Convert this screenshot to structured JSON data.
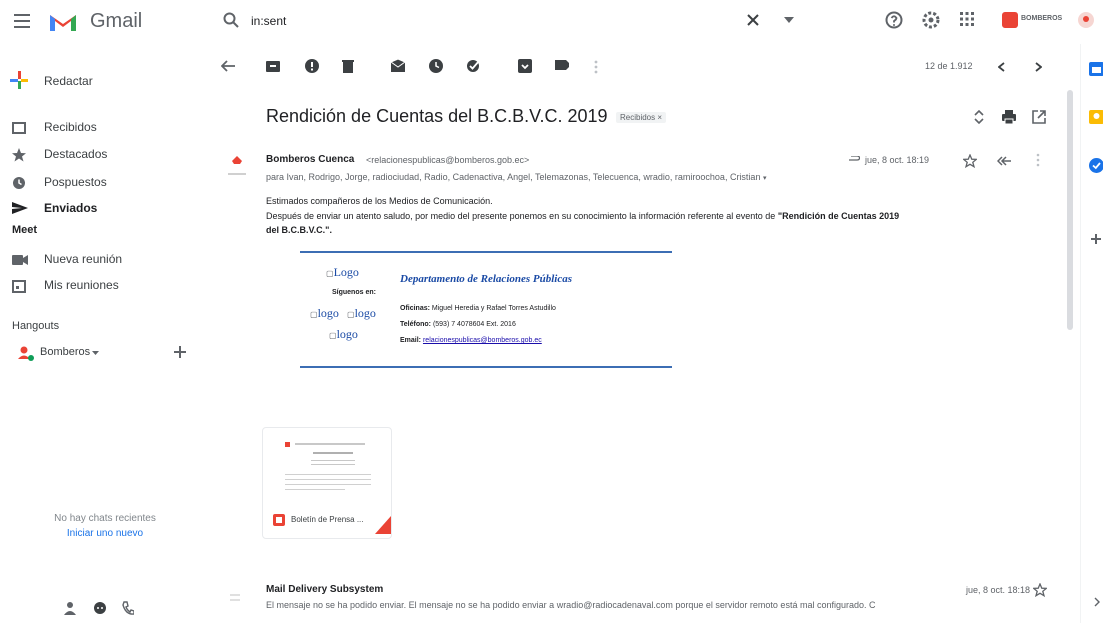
{
  "app": {
    "name": "Gmail"
  },
  "search": {
    "value": "in:sent"
  },
  "account": {
    "name": "BOMBEROS"
  },
  "compose": {
    "label": "Redactar"
  },
  "sidebar": {
    "items": [
      {
        "label": "Recibidos"
      },
      {
        "label": "Destacados"
      },
      {
        "label": "Pospuestos"
      },
      {
        "label": "Enviados"
      }
    ]
  },
  "meet": {
    "title": "Meet",
    "items": [
      {
        "label": "Nueva reunión"
      },
      {
        "label": "Mis reuniones"
      }
    ]
  },
  "hangouts": {
    "title": "Hangouts",
    "user": "Bomberos",
    "empty_line1": "No hay chats recientes",
    "empty_line2": "Iniciar uno nuevo"
  },
  "pagination": {
    "text": "12 de 1.912"
  },
  "email": {
    "subject": "Rendición de Cuentas del B.C.B.V.C. 2019",
    "label": "Recibidos",
    "sender_name": "Bomberos Cuenca",
    "sender_email": "<relacionespublicas@bomberos.gob.ec>",
    "date": "jue, 8 oct. 18:19",
    "recipients": "para Ivan, Rodrigo, Jorge, radiociudad, Radio, Cadenactiva, Angel, Telemazonas, Telecuenca, wradio, ramiroochoa, Cristian",
    "body_line1": "Estimados compañeros de los Medios de Comunicación.",
    "body_line2_a": "Después de enviar un atento saludo, por medio del presente ponemos en su conocimiento la información referente al evento de ",
    "body_line2_b": "\"Rendición de Cuentas 2019",
    "body_line3": "del B.C.B.V.C.\".",
    "signature": {
      "logo": "Logo",
      "follow": "Síguenos en:",
      "logo_small": "logo",
      "department": "Departamento de Relaciones Públicas",
      "offices_label": "Oficinas:",
      "offices_value": "Miguel Heredia y Rafael Torres Astudillo",
      "phone_label": "Teléfono:",
      "phone_value": "(593) 7 4078604 Ext. 2016",
      "email_label": "Email:",
      "email_value": "relacionespublicas@bomberos.gob.ec"
    },
    "attachment": {
      "name": "Boletín de Prensa ..."
    }
  },
  "reply": {
    "sender": "Mail Delivery Subsystem",
    "date": "jue, 8 oct. 18:18",
    "snippet": "El mensaje no se ha podido enviar. El mensaje no se ha podido enviar a wradio@radiocadenaval.com porque el servidor remoto está mal configurado. C"
  },
  "colors": {
    "accent_blue": "#1a73e8",
    "gmail_red": "#ea4335",
    "signature_blue": "#3c6eb4"
  }
}
